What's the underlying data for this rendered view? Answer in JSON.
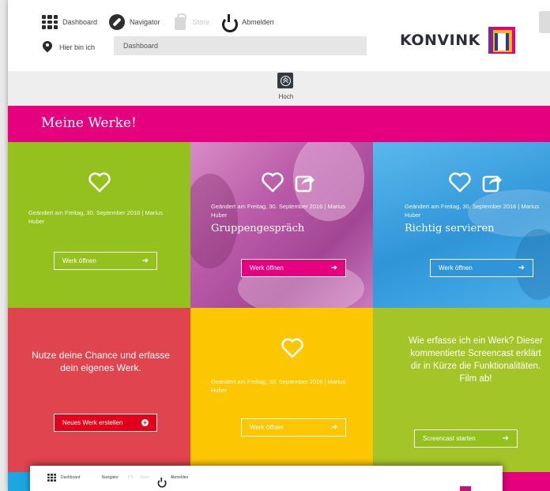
{
  "nav": {
    "dashboard": "Dashboard",
    "navigator": "Navigator",
    "store": "Store",
    "logout": "Abmelden"
  },
  "location": {
    "label": "Hier bin ich",
    "value": "Dashboard"
  },
  "logo": {
    "text": "KONVINK"
  },
  "hoch": {
    "label": "Hoch"
  },
  "section": {
    "title": "Meine Werke!"
  },
  "tiles": [
    {
      "meta": "Geändert am Freitag, 30. September 2016 | Marius Huber",
      "button": "Werk öffnen",
      "color": "#94c11e"
    },
    {
      "meta": "Geändert am Freitag, 30. September 2016 | Marius Huber",
      "title": "Gruppengespräch",
      "button": "Werk öffnen",
      "color": "#c869b2"
    },
    {
      "meta": "Geändert am Freitag, 30. September 2016 | Marius Huber",
      "title": "Richtig servieren",
      "button": "Werk öffnen",
      "color": "#3ba6e2"
    },
    {
      "text": "Nutze deine Chance und erfasse dein eigenes Werk.",
      "button": "Neues Werk erstellen",
      "color": "#e0444e"
    },
    {
      "meta": "Geändert am Freitag, 30. September 2016 | Marius Huber",
      "button": "Werk öffnen",
      "color": "#fdc700"
    },
    {
      "text": "Wie erfasse ich ein Werk? Dieser kommentierte Screencast erklärt dir in Kürze die Funktionalitäten. Film ab!",
      "button": "Screencast starten",
      "color": "#a4c528"
    }
  ],
  "overlay_nav": {
    "dashboard": "Dashboard",
    "navigator": "Navigator",
    "store": "Store",
    "logout": "Abmelden"
  },
  "colors": {
    "accent_pink": "#e5007d",
    "green": "#94c11e",
    "blue": "#3ba6e2",
    "red": "#e0444e",
    "yellow": "#fdc700"
  },
  "icons": [
    "grid-icon",
    "compass-icon",
    "shopping-bag-icon",
    "power-icon",
    "location-pin-icon",
    "chevron-up-circle-icon",
    "heart-icon",
    "share-icon",
    "arrow-right-icon",
    "plus-circle-icon"
  ]
}
